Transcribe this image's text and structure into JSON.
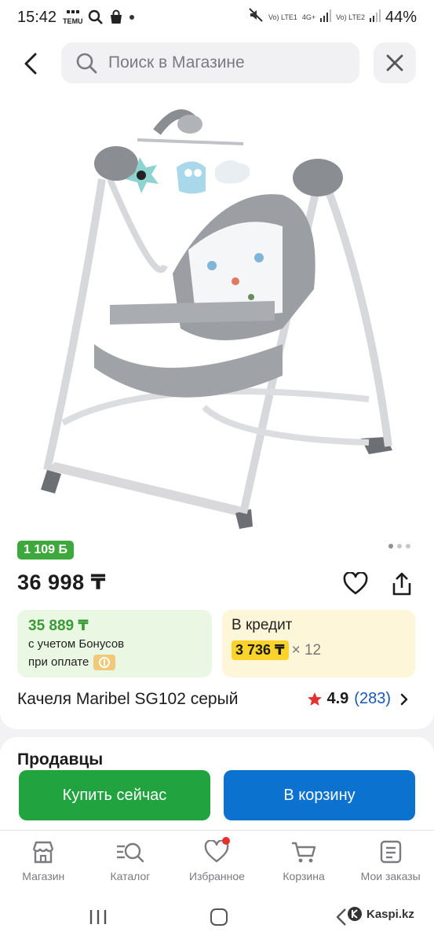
{
  "status_bar": {
    "time": "15:42",
    "temu_label": "TEMU",
    "network1": "Vo) LTE1",
    "network2": "4G+",
    "network3": "Vo) LTE2",
    "battery": "44%"
  },
  "header": {
    "search_placeholder": "Поиск в Магазине"
  },
  "product": {
    "bonus_badge": "1 109 Б",
    "price": "36 998 ₸",
    "bonus_price": "35 889 ₸",
    "bonus_line1": "с учетом Бонусов",
    "bonus_line2": "при оплате",
    "credit_label": "В кредит",
    "credit_amount": "3 736 ₸",
    "credit_multiplier": "× 12",
    "title": "Качеля Maribel SG102 серый",
    "rating": "4.9",
    "reviews": "(283)",
    "image_count": 3,
    "active_image": 1
  },
  "sellers": {
    "heading": "Продавцы"
  },
  "actions": {
    "buy_now": "Купить сейчас",
    "add_to_cart": "В корзину"
  },
  "nav": {
    "items": [
      {
        "label": "Магазин",
        "icon": "shop-icon"
      },
      {
        "label": "Каталог",
        "icon": "catalog-search-icon"
      },
      {
        "label": "Избранное",
        "icon": "heart-icon"
      },
      {
        "label": "Корзина",
        "icon": "cart-icon"
      },
      {
        "label": "Мои заказы",
        "icon": "orders-icon"
      }
    ]
  },
  "watermark": "Kaspi.kz",
  "colors": {
    "bonus_green": "#3ea83d",
    "buy_green": "#21a33f",
    "cart_blue": "#0c72cf",
    "credit_yellow": "#fcd32a",
    "star_red": "#e0322f",
    "link_blue": "#1a57b5"
  }
}
